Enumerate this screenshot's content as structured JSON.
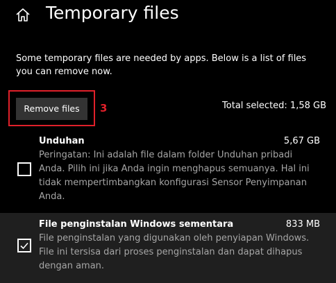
{
  "header": {
    "title": "Temporary files",
    "home_icon": "home-icon"
  },
  "description": "Some temporary files are needed by apps. Below is a list of files you can remove now.",
  "actions": {
    "remove_label": "Remove files",
    "step_annotation": "3",
    "total_selected": "Total selected: 1,58 GB"
  },
  "items": [
    {
      "name": "Unduhan",
      "size": "5,67 GB",
      "description": "Peringatan: Ini adalah file dalam folder Unduhan pribadi Anda. Pilih ini jika Anda ingin menghapus semuanya. Hal ini tidak mempertimbangkan konfigurasi Sensor Penyimpanan Anda.",
      "checked": false
    },
    {
      "name": "File penginstalan Windows sementara",
      "size": "833 MB",
      "description": "File penginstalan yang digunakan oleh penyiapan Windows. File ini tersisa dari proses penginstalan dan dapat dihapus dengan aman.",
      "checked": true
    }
  ],
  "colors": {
    "background": "#000000",
    "button": "#333333",
    "annotation_red": "#e0202a",
    "selected_row": "#1f1f1f",
    "secondary_text": "#a6a6a6"
  }
}
